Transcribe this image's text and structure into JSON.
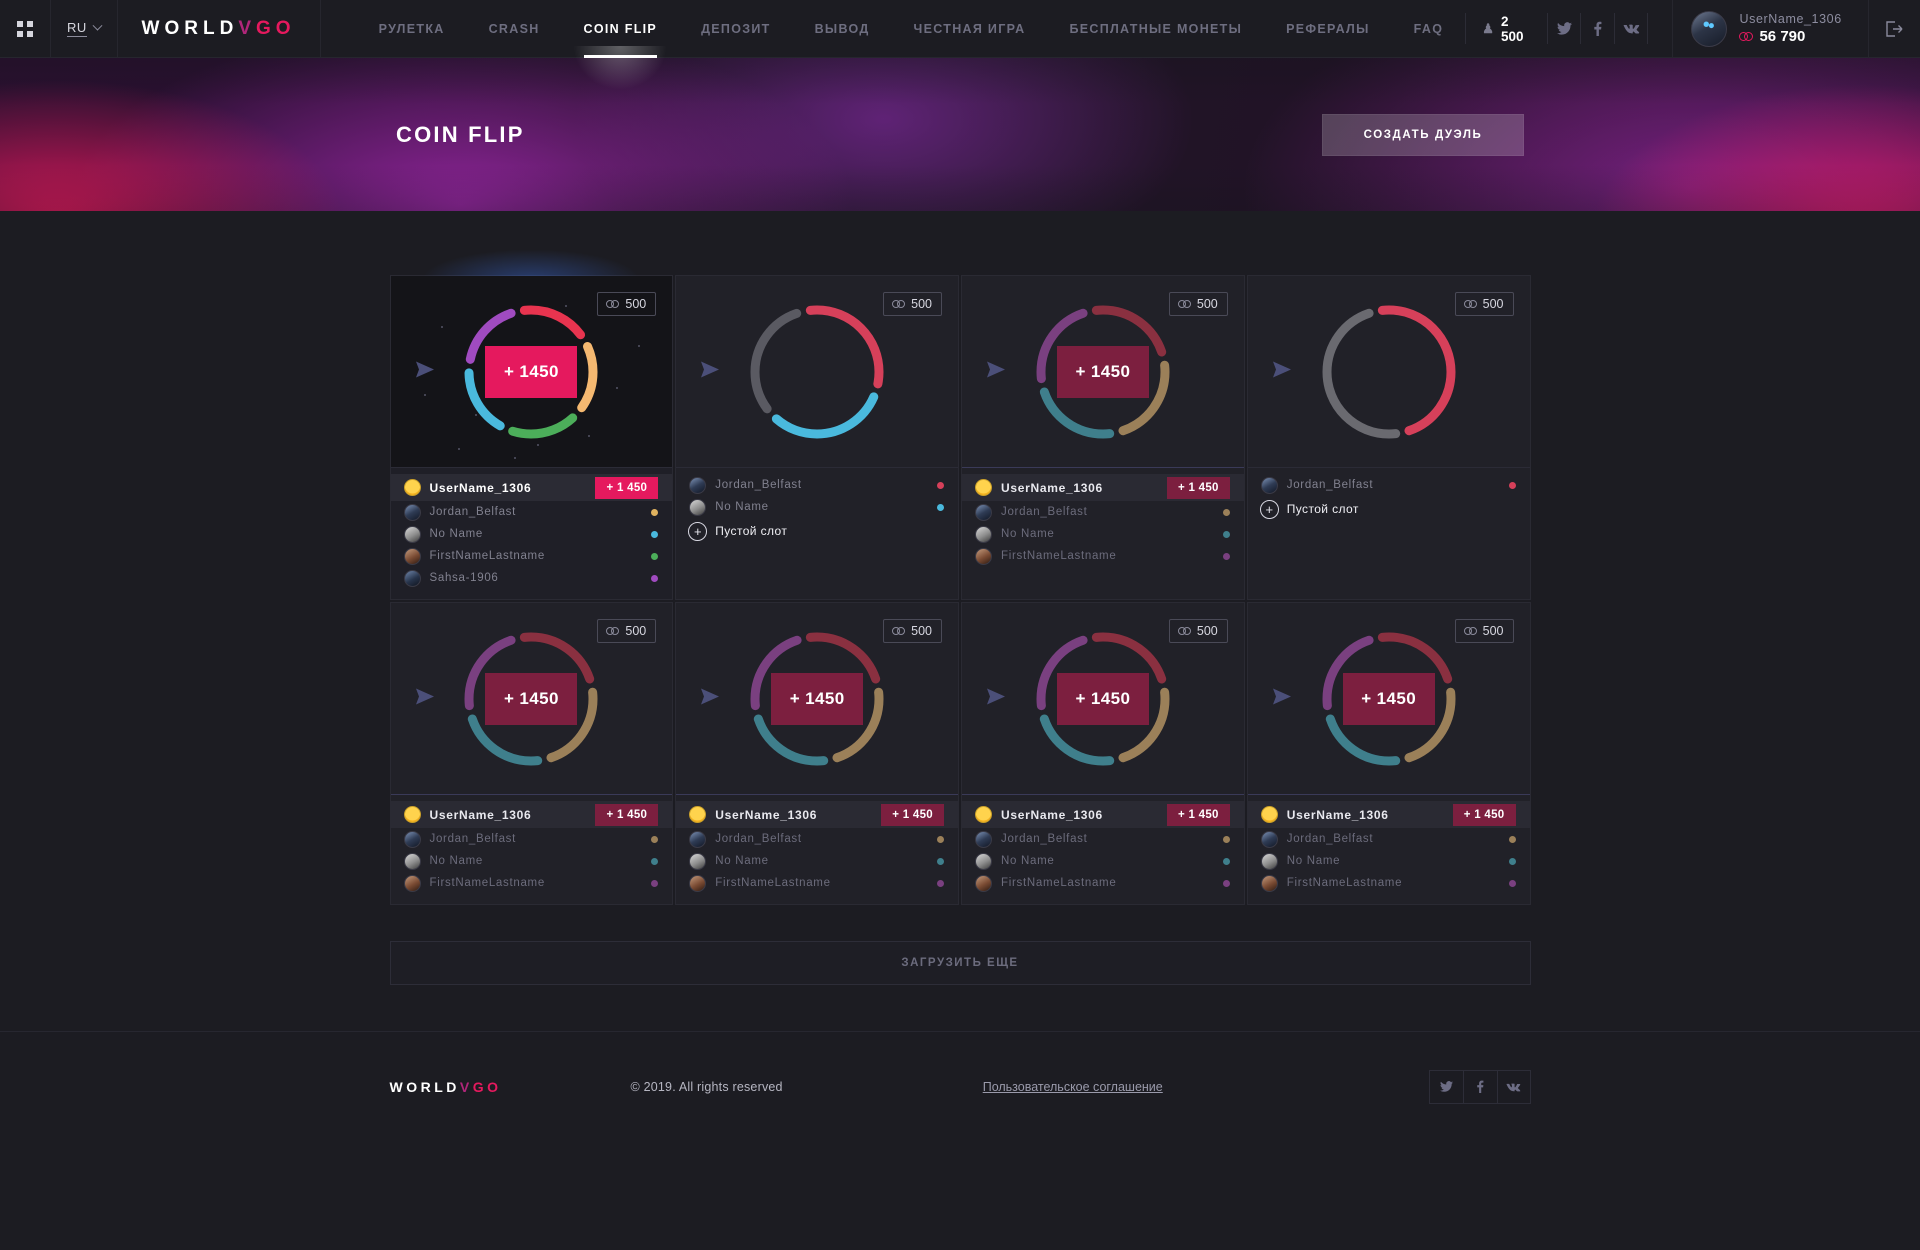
{
  "brand": {
    "word1": "WORLD",
    "v": "V",
    "g": "G",
    "o": "O"
  },
  "topbar": {
    "grid_icon": "grid-icon",
    "language": "RU",
    "nav": [
      {
        "label": "РУЛЕТКА",
        "active": false
      },
      {
        "label": "CRASH",
        "active": false
      },
      {
        "label": "COIN FLIP",
        "active": true
      },
      {
        "label": "ДЕПОЗИТ",
        "active": false
      },
      {
        "label": "ВЫВОД",
        "active": false
      },
      {
        "label": "ЧЕСТНАЯ ИГРА",
        "active": false
      },
      {
        "label": "БЕСПЛАТНЫЕ МОНЕТЫ",
        "active": false
      },
      {
        "label": "РЕФЕРАЛЫ",
        "active": false
      },
      {
        "label": "FAQ",
        "active": false
      }
    ],
    "online_count": "2 500",
    "socials": [
      "twitter-icon",
      "facebook-icon",
      "vk-icon"
    ],
    "user": {
      "name": "UserName_1306",
      "balance": "56 790"
    },
    "logout_icon": "logout-icon"
  },
  "hero": {
    "title": "COIN FLIP",
    "create_button": "СОЗДАТЬ ДУЭЛЬ"
  },
  "cards": [
    {
      "state": "active",
      "bet": "500",
      "center_value": "+ 1450",
      "center_style": "pink",
      "ring": [
        {
          "color": "#e8344f",
          "pct": 20
        },
        {
          "color": "#f5b971",
          "pct": 20
        },
        {
          "color": "#4cae5a",
          "pct": 20
        },
        {
          "color": "#4ab9dd",
          "pct": 20
        },
        {
          "color": "#a04bc0",
          "pct": 20
        }
      ],
      "players": [
        {
          "name": "UserName_1306",
          "avatar": "a1",
          "win": true,
          "win_amount": "+ 1 450",
          "color": "#e8344f"
        },
        {
          "name": "Jordan_Belfast",
          "avatar": "a2",
          "win": false,
          "color": "#e0b25f"
        },
        {
          "name": "No Name",
          "avatar": "a3",
          "win": false,
          "color": "#4ab9dd"
        },
        {
          "name": "FirstNameLastname",
          "avatar": "a4",
          "win": false,
          "color": "#4cae5a"
        },
        {
          "name": "Sahsa-1906",
          "avatar": "a5",
          "win": false,
          "color": "#a04bc0"
        }
      ],
      "empty_slot": null
    },
    {
      "state": "open",
      "bet": "500",
      "center_value": "",
      "center_style": "none",
      "ring": [
        {
          "color": "#d6405a",
          "pct": 33.3
        },
        {
          "color": "#4ab9dd",
          "pct": 33.3
        },
        {
          "color": "#5a5a62",
          "pct": 33.3
        }
      ],
      "players": [
        {
          "name": "Jordan_Belfast",
          "avatar": "a2",
          "win": false,
          "color": "#d6405a"
        },
        {
          "name": "No Name",
          "avatar": "a3",
          "win": false,
          "color": "#4ab9dd"
        }
      ],
      "empty_slot": "Пустой слот"
    },
    {
      "state": "done",
      "bet": "500",
      "center_value": "+ 1450",
      "center_style": "dark",
      "ring": [
        {
          "color": "#8a3040",
          "pct": 25
        },
        {
          "color": "#9b8059",
          "pct": 25
        },
        {
          "color": "#3f7f8c",
          "pct": 25
        },
        {
          "color": "#7a4080",
          "pct": 25
        }
      ],
      "players": [
        {
          "name": "UserName_1306",
          "avatar": "a1",
          "win": true,
          "win_amount": "+ 1 450",
          "color": "#8a3040"
        },
        {
          "name": "Jordan_Belfast",
          "avatar": "a2",
          "win": false,
          "color": "#9b8059"
        },
        {
          "name": "No Name",
          "avatar": "a3",
          "win": false,
          "color": "#3f7f8c"
        },
        {
          "name": "FirstNameLastname",
          "avatar": "a4",
          "win": false,
          "color": "#7a4080"
        }
      ],
      "empty_slot": null
    },
    {
      "state": "open",
      "bet": "500",
      "center_value": "",
      "center_style": "none",
      "ring": [
        {
          "color": "#d6405a",
          "pct": 50
        },
        {
          "color": "#6a6a70",
          "pct": 50
        }
      ],
      "players": [
        {
          "name": "Jordan_Belfast",
          "avatar": "a2",
          "win": false,
          "color": "#d6405a"
        }
      ],
      "empty_slot": "Пустой слот"
    },
    {
      "state": "done",
      "bet": "500",
      "center_value": "+ 1450",
      "center_style": "dark",
      "ring": [
        {
          "color": "#8a3040",
          "pct": 25
        },
        {
          "color": "#9b8059",
          "pct": 25
        },
        {
          "color": "#3f7f8c",
          "pct": 25
        },
        {
          "color": "#7a4080",
          "pct": 25
        }
      ],
      "players": [
        {
          "name": "UserName_1306",
          "avatar": "a1",
          "win": true,
          "win_amount": "+ 1 450",
          "color": "#8a3040"
        },
        {
          "name": "Jordan_Belfast",
          "avatar": "a2",
          "win": false,
          "color": "#9b8059"
        },
        {
          "name": "No Name",
          "avatar": "a3",
          "win": false,
          "color": "#3f7f8c"
        },
        {
          "name": "FirstNameLastname",
          "avatar": "a4",
          "win": false,
          "color": "#7a4080"
        }
      ],
      "empty_slot": null
    },
    {
      "state": "done",
      "bet": "500",
      "center_value": "+ 1450",
      "center_style": "dark",
      "ring": [
        {
          "color": "#8a3040",
          "pct": 25
        },
        {
          "color": "#9b8059",
          "pct": 25
        },
        {
          "color": "#3f7f8c",
          "pct": 25
        },
        {
          "color": "#7a4080",
          "pct": 25
        }
      ],
      "players": [
        {
          "name": "UserName_1306",
          "avatar": "a1",
          "win": true,
          "win_amount": "+ 1 450",
          "color": "#8a3040"
        },
        {
          "name": "Jordan_Belfast",
          "avatar": "a2",
          "win": false,
          "color": "#9b8059"
        },
        {
          "name": "No Name",
          "avatar": "a3",
          "win": false,
          "color": "#3f7f8c"
        },
        {
          "name": "FirstNameLastname",
          "avatar": "a4",
          "win": false,
          "color": "#7a4080"
        }
      ],
      "empty_slot": null
    },
    {
      "state": "done",
      "bet": "500",
      "center_value": "+ 1450",
      "center_style": "dark",
      "ring": [
        {
          "color": "#8a3040",
          "pct": 25
        },
        {
          "color": "#9b8059",
          "pct": 25
        },
        {
          "color": "#3f7f8c",
          "pct": 25
        },
        {
          "color": "#7a4080",
          "pct": 25
        }
      ],
      "players": [
        {
          "name": "UserName_1306",
          "avatar": "a1",
          "win": true,
          "win_amount": "+ 1 450",
          "color": "#8a3040"
        },
        {
          "name": "Jordan_Belfast",
          "avatar": "a2",
          "win": false,
          "color": "#9b8059"
        },
        {
          "name": "No Name",
          "avatar": "a3",
          "win": false,
          "color": "#3f7f8c"
        },
        {
          "name": "FirstNameLastname",
          "avatar": "a4",
          "win": false,
          "color": "#7a4080"
        }
      ],
      "empty_slot": null
    },
    {
      "state": "done",
      "bet": "500",
      "center_value": "+ 1450",
      "center_style": "dark",
      "ring": [
        {
          "color": "#8a3040",
          "pct": 25
        },
        {
          "color": "#9b8059",
          "pct": 25
        },
        {
          "color": "#3f7f8c",
          "pct": 25
        },
        {
          "color": "#7a4080",
          "pct": 25
        }
      ],
      "players": [
        {
          "name": "UserName_1306",
          "avatar": "a1",
          "win": true,
          "win_amount": "+ 1 450",
          "color": "#8a3040"
        },
        {
          "name": "Jordan_Belfast",
          "avatar": "a2",
          "win": false,
          "color": "#9b8059"
        },
        {
          "name": "No Name",
          "avatar": "a3",
          "win": false,
          "color": "#3f7f8c"
        },
        {
          "name": "FirstNameLastname",
          "avatar": "a4",
          "win": false,
          "color": "#7a4080"
        }
      ],
      "empty_slot": null
    }
  ],
  "load_more": "ЗАГРУЗИТЬ ЕЩЕ",
  "footer": {
    "copyright": "© 2019. All rights reserved",
    "agreement": "Пользовательское соглашение",
    "socials": [
      "twitter-icon",
      "facebook-icon",
      "vk-icon"
    ]
  },
  "colors": {
    "accent": "#e5195e",
    "accent_dark": "#7c1f3f",
    "bg": "#1c1c22",
    "card": "#212128"
  }
}
